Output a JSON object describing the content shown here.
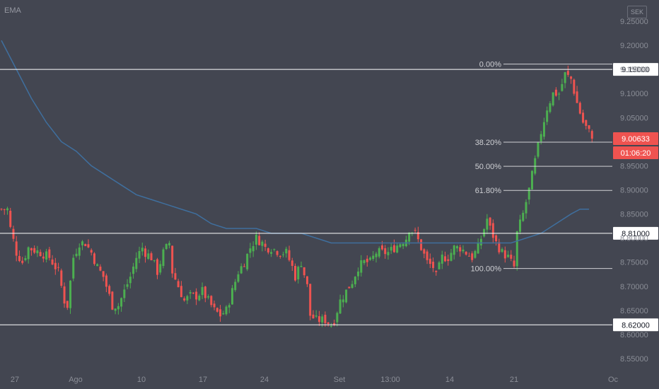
{
  "indicator_label": "EMA",
  "currency": "SEK",
  "countdown": "01:06:20",
  "colors": {
    "background": "#434651",
    "up": "#4caf50",
    "down": "#ef5350",
    "ema": "#3f6f9e",
    "hline": "#ffffff",
    "fib": "#cfd0d4",
    "text": "#b2b5be",
    "last_price_tag": "#ef5350"
  },
  "chart_data": {
    "type": "candlestick",
    "title": "",
    "xlabel": "",
    "ylabel": "",
    "ylim": [
      8.52,
      9.25
    ],
    "y_ticks": [
      "9.25000",
      "9.20000",
      "9.15000",
      "9.10000",
      "9.05000",
      "9.00000",
      "8.95000",
      "8.90000",
      "8.85000",
      "8.80000",
      "8.75000",
      "8.70000",
      "8.65000",
      "8.60000",
      "8.55000"
    ],
    "x_ticks": [
      "27",
      "Ago",
      "10",
      "17",
      "24",
      "Set",
      "13:00",
      "14",
      "21",
      "Oc"
    ],
    "horizontal_levels": [
      {
        "label": "9.15000",
        "value": 9.15
      },
      {
        "label": "8.81000",
        "value": 8.81
      },
      {
        "label": "8.62000",
        "value": 8.62
      }
    ],
    "last_price": {
      "label": "9.00633",
      "value": 9.00633
    },
    "fibonacci": {
      "high": 9.161,
      "low": 8.737,
      "levels": [
        {
          "label": "0.00%",
          "ratio": 0.0
        },
        {
          "label": "38.20%",
          "ratio": 0.382
        },
        {
          "label": "50.00%",
          "ratio": 0.5
        },
        {
          "label": "61.80%",
          "ratio": 0.618
        },
        {
          "label": "100.00%",
          "ratio": 1.0
        }
      ]
    },
    "close_path": [
      [
        0,
        8.86
      ],
      [
        2,
        8.86
      ],
      [
        3,
        8.82
      ],
      [
        5,
        8.77
      ],
      [
        7,
        8.75
      ],
      [
        9,
        8.78
      ],
      [
        13,
        8.77
      ],
      [
        16,
        8.76
      ],
      [
        19,
        8.73
      ],
      [
        21,
        8.67
      ],
      [
        22,
        8.66
      ],
      [
        24,
        8.76
      ],
      [
        26,
        8.79
      ],
      [
        28,
        8.79
      ],
      [
        30,
        8.77
      ],
      [
        32,
        8.74
      ],
      [
        34,
        8.72
      ],
      [
        36,
        8.68
      ],
      [
        37,
        8.66
      ],
      [
        39,
        8.66
      ],
      [
        41,
        8.69
      ],
      [
        43,
        8.72
      ],
      [
        45,
        8.76
      ],
      [
        47,
        8.78
      ],
      [
        48,
        8.77
      ],
      [
        50,
        8.76
      ],
      [
        52,
        8.73
      ],
      [
        54,
        8.77
      ],
      [
        56,
        8.79
      ],
      [
        57,
        8.73
      ],
      [
        59,
        8.7
      ],
      [
        61,
        8.67
      ],
      [
        63,
        8.68
      ],
      [
        65,
        8.68
      ],
      [
        67,
        8.69
      ],
      [
        69,
        8.67
      ],
      [
        71,
        8.65
      ],
      [
        73,
        8.64
      ],
      [
        75,
        8.65
      ],
      [
        77,
        8.69
      ],
      [
        79,
        8.73
      ],
      [
        81,
        8.75
      ],
      [
        83,
        8.78
      ],
      [
        85,
        8.8
      ],
      [
        87,
        8.79
      ],
      [
        88,
        8.78
      ],
      [
        90,
        8.78
      ],
      [
        93,
        8.77
      ],
      [
        95,
        8.77
      ],
      [
        97,
        8.74
      ],
      [
        98,
        8.72
      ],
      [
        100,
        8.75
      ],
      [
        102,
        8.7
      ],
      [
        103,
        8.64
      ],
      [
        105,
        8.63
      ],
      [
        108,
        8.63
      ],
      [
        110,
        8.62
      ],
      [
        111,
        8.63
      ],
      [
        113,
        8.67
      ],
      [
        115,
        8.69
      ],
      [
        117,
        8.71
      ],
      [
        119,
        8.74
      ],
      [
        121,
        8.75
      ],
      [
        123,
        8.75
      ],
      [
        125,
        8.77
      ],
      [
        127,
        8.77
      ],
      [
        129,
        8.77
      ],
      [
        131,
        8.78
      ],
      [
        133,
        8.79
      ],
      [
        135,
        8.8
      ],
      [
        136,
        8.82
      ],
      [
        138,
        8.81
      ],
      [
        140,
        8.78
      ],
      [
        142,
        8.75
      ],
      [
        144,
        8.74
      ],
      [
        145,
        8.72
      ],
      [
        147,
        8.76
      ],
      [
        149,
        8.76
      ],
      [
        151,
        8.78
      ],
      [
        153,
        8.78
      ],
      [
        155,
        8.77
      ],
      [
        157,
        8.76
      ],
      [
        159,
        8.78
      ],
      [
        161,
        8.82
      ],
      [
        162,
        8.84
      ],
      [
        163,
        8.82
      ],
      [
        165,
        8.79
      ],
      [
        167,
        8.77
      ],
      [
        169,
        8.76
      ],
      [
        171,
        8.74
      ],
      [
        172,
        8.81
      ],
      [
        174,
        8.85
      ],
      [
        176,
        8.9
      ],
      [
        178,
        8.96
      ],
      [
        180,
        9.02
      ],
      [
        182,
        9.07
      ],
      [
        184,
        9.1
      ],
      [
        186,
        9.1
      ],
      [
        188,
        9.14
      ],
      [
        190,
        9.13
      ],
      [
        192,
        9.08
      ],
      [
        194,
        9.04
      ],
      [
        196,
        9.02
      ],
      [
        197,
        9.00633
      ]
    ],
    "ema_path": [
      [
        0,
        9.21
      ],
      [
        5,
        9.15
      ],
      [
        10,
        9.09
      ],
      [
        15,
        9.04
      ],
      [
        20,
        9.0
      ],
      [
        25,
        8.98
      ],
      [
        30,
        8.95
      ],
      [
        35,
        8.93
      ],
      [
        40,
        8.91
      ],
      [
        45,
        8.89
      ],
      [
        50,
        8.88
      ],
      [
        55,
        8.87
      ],
      [
        60,
        8.86
      ],
      [
        65,
        8.85
      ],
      [
        70,
        8.83
      ],
      [
        75,
        8.82
      ],
      [
        80,
        8.82
      ],
      [
        85,
        8.82
      ],
      [
        90,
        8.81
      ],
      [
        95,
        8.81
      ],
      [
        100,
        8.81
      ],
      [
        105,
        8.8
      ],
      [
        110,
        8.79
      ],
      [
        115,
        8.79
      ],
      [
        120,
        8.79
      ],
      [
        125,
        8.79
      ],
      [
        130,
        8.79
      ],
      [
        135,
        8.79
      ],
      [
        140,
        8.79
      ],
      [
        145,
        8.79
      ],
      [
        150,
        8.79
      ],
      [
        155,
        8.79
      ],
      [
        160,
        8.79
      ],
      [
        165,
        8.79
      ],
      [
        170,
        8.79
      ],
      [
        175,
        8.8
      ],
      [
        180,
        8.81
      ],
      [
        185,
        8.83
      ],
      [
        190,
        8.85
      ],
      [
        193,
        8.86
      ],
      [
        196,
        8.86
      ]
    ]
  }
}
